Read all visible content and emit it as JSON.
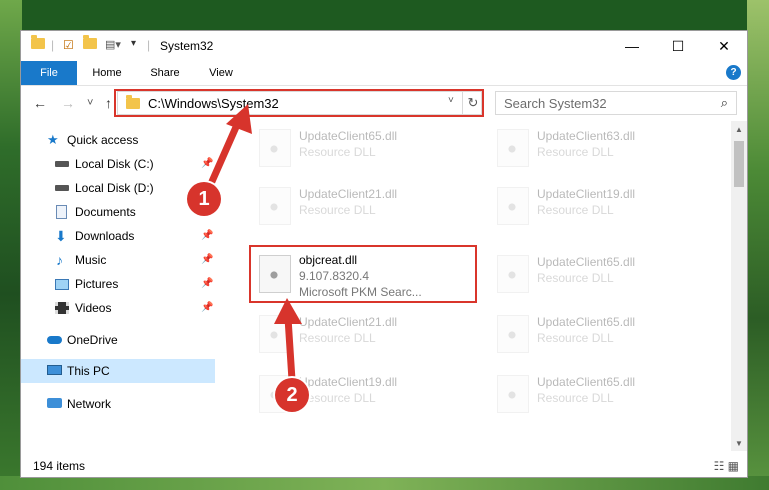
{
  "window": {
    "title": "System32",
    "minimize_glyph": "—",
    "maximize_glyph": "☐",
    "close_glyph": "✕"
  },
  "ribbon": {
    "tabs": [
      "File",
      "Home",
      "Share",
      "View"
    ],
    "help_label": "?"
  },
  "nav": {
    "back_glyph": "←",
    "forward_glyph": "→",
    "recent_glyph": "˅",
    "up_glyph": "↑"
  },
  "address": {
    "path": "C:\\Windows\\System32",
    "refresh_glyph": "↻",
    "dropdown_glyph": "˅"
  },
  "search": {
    "placeholder": "Search System32",
    "icon_glyph": "⌕"
  },
  "sidebar": {
    "items": [
      {
        "label": "Quick access",
        "icon": "star-icon",
        "pinned": false
      },
      {
        "label": "Local Disk (C:)",
        "icon": "drive-icon",
        "pinned": true
      },
      {
        "label": "Local Disk (D:)",
        "icon": "drive-icon",
        "pinned": true
      },
      {
        "label": "Documents",
        "icon": "documents-icon",
        "pinned": true
      },
      {
        "label": "Downloads",
        "icon": "downloads-icon",
        "pinned": true
      },
      {
        "label": "Music",
        "icon": "music-icon",
        "pinned": true
      },
      {
        "label": "Pictures",
        "icon": "pictures-icon",
        "pinned": true
      },
      {
        "label": "Videos",
        "icon": "videos-icon",
        "pinned": true
      },
      {
        "label": "OneDrive",
        "icon": "cloud-icon",
        "pinned": false
      },
      {
        "label": "This PC",
        "icon": "computer-icon",
        "pinned": false,
        "selected": true
      },
      {
        "label": "Network",
        "icon": "network-icon",
        "pinned": false
      }
    ],
    "pin_glyph": "📌"
  },
  "files": [
    {
      "name": "UpdateClient65.dll",
      "sub": "Resource DLL"
    },
    {
      "name": "UpdateClient63.dll",
      "sub": "Resource DLL"
    },
    {
      "name": "UpdateClient21.dll",
      "sub": "Resource DLL"
    },
    {
      "name": "UpdateClient19.dll",
      "sub": "Resource DLL"
    },
    {
      "name": "objcreat.dll",
      "sub": "9.107.8320.4",
      "sub2": "Microsoft PKM Searc...",
      "highlighted": true
    },
    {
      "name": "UpdateClient65.dll",
      "sub": "Resource DLL"
    },
    {
      "name": "UpdateClient21.dll",
      "sub": "Resource DLL"
    },
    {
      "name": "UpdateClient65.dll",
      "sub": "Resource DLL"
    },
    {
      "name": "UpdateClient19.dll",
      "sub": "Resource DLL"
    },
    {
      "name": "UpdateClient65.dll",
      "sub": "Resource DLL"
    }
  ],
  "status": {
    "count": "194 items",
    "view_glyphs": "☷ ▦"
  },
  "callouts": [
    "1",
    "2"
  ],
  "colors": {
    "accent": "#1979ca",
    "highlight_red": "#d9352b",
    "selection": "#cce8ff"
  }
}
